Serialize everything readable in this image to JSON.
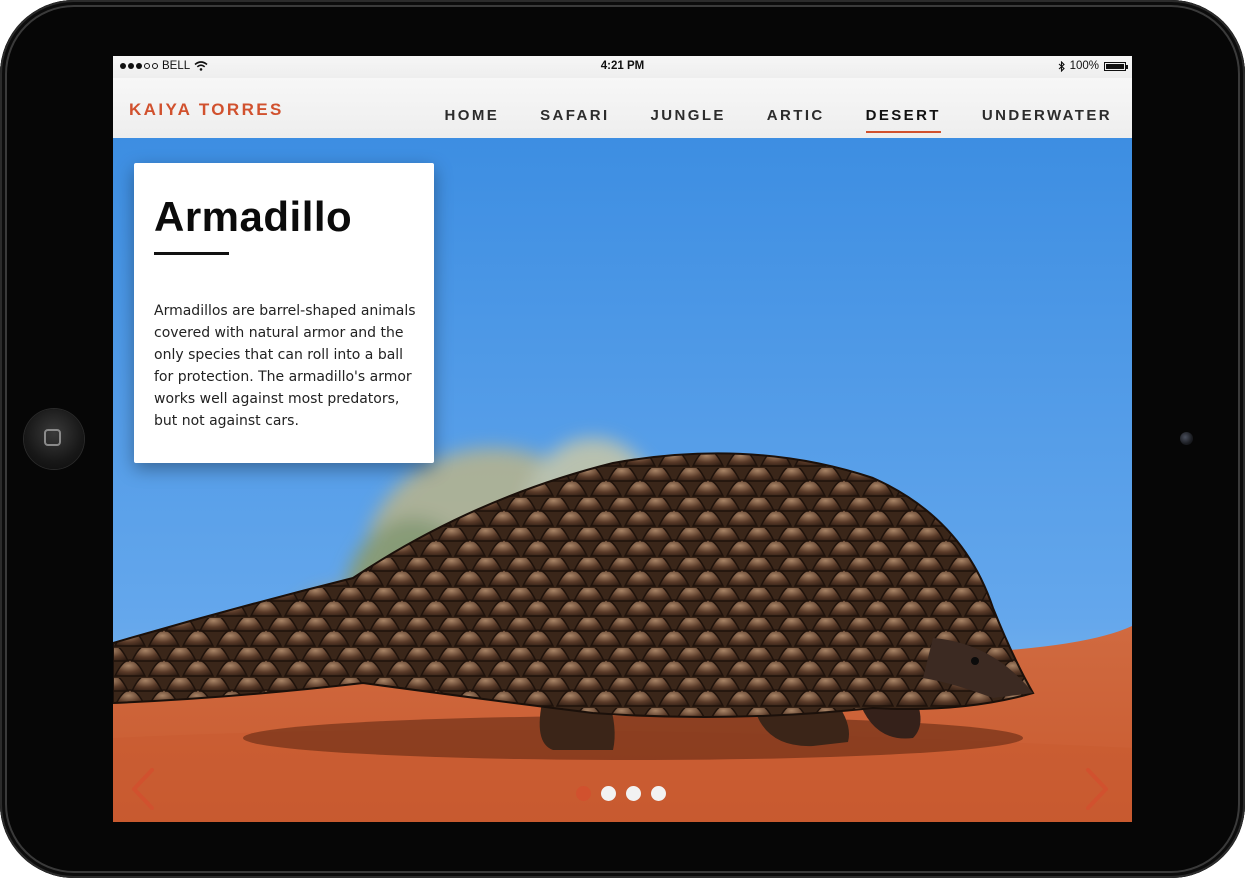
{
  "status_bar": {
    "carrier": "BELL",
    "time": "4:21 PM",
    "battery": "100%"
  },
  "header": {
    "brand": "KAIYA TORRES",
    "nav": [
      {
        "label": "HOME",
        "active": false
      },
      {
        "label": "SAFARI",
        "active": false
      },
      {
        "label": "JUNGLE",
        "active": false
      },
      {
        "label": "ARTIC",
        "active": false
      },
      {
        "label": "DESERT",
        "active": true
      },
      {
        "label": "UNDERWATER",
        "active": false
      }
    ]
  },
  "slide": {
    "title": "Armadillo",
    "description": "Armadillos are barrel-shaped animals covered with natural armor and the only species that can roll into a ball for protection. The armadillo's armor works well against most predators, but not against cars."
  },
  "carousel": {
    "slide_count": 4,
    "active_index": 0
  },
  "colors": {
    "accent": "#d1512e",
    "sky": "#3f8fe0",
    "sand": "#d56a3c"
  },
  "icons": {
    "prev": "chevron-left-icon",
    "next": "chevron-right-icon",
    "wifi": "wifi-icon",
    "bluetooth": "bluetooth-icon",
    "battery": "battery-icon"
  }
}
